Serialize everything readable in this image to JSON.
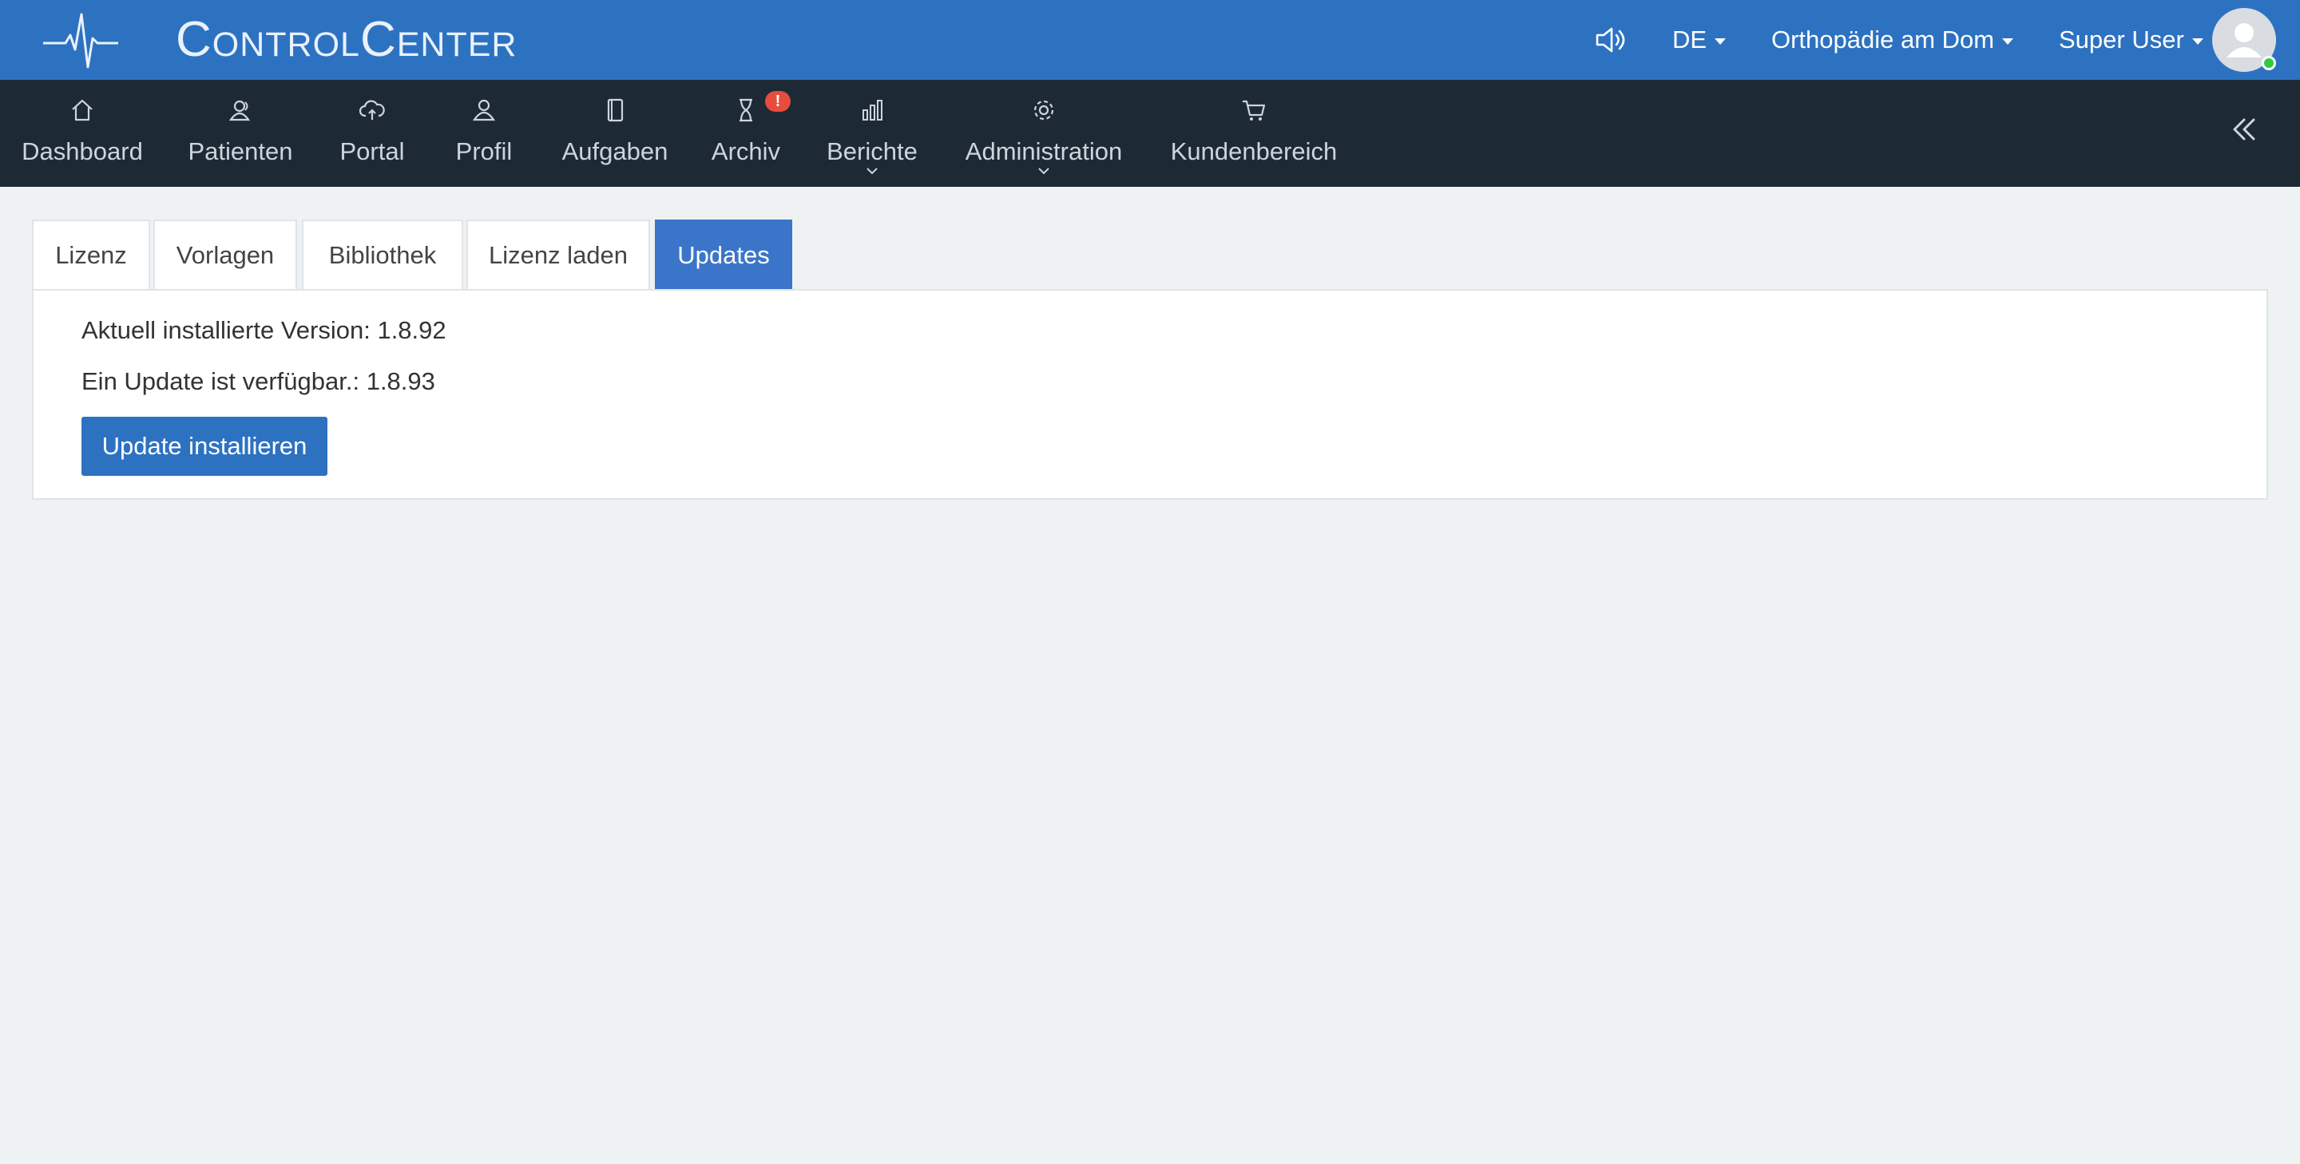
{
  "header": {
    "app_title": "ControlCenter",
    "language": "DE",
    "practice": "Orthopädie am Dom",
    "user": "Super User",
    "brand_color": "#2d72c1"
  },
  "nav": {
    "items": [
      {
        "label": "Dashboard",
        "icon": "home-icon"
      },
      {
        "label": "Patienten",
        "icon": "patients-icon"
      },
      {
        "label": "Portal",
        "icon": "cloud-upload-icon"
      },
      {
        "label": "Profil",
        "icon": "user-icon"
      },
      {
        "label": "Aufgaben",
        "icon": "notebook-icon"
      },
      {
        "label": "Archiv",
        "icon": "hourglass-icon",
        "badge": "!"
      },
      {
        "label": "Berichte",
        "icon": "bar-chart-icon",
        "dropdown": true
      },
      {
        "label": "Administration",
        "icon": "gear-icon",
        "dropdown": true
      },
      {
        "label": "Kundenbereich",
        "icon": "cart-icon"
      }
    ]
  },
  "tabs": [
    {
      "label": "Lizenz",
      "active": false
    },
    {
      "label": "Vorlagen",
      "active": false
    },
    {
      "label": "Bibliothek",
      "active": false
    },
    {
      "label": "Lizenz laden",
      "active": false
    },
    {
      "label": "Updates",
      "active": true
    }
  ],
  "updates": {
    "installed_text": "Aktuell installierte Version: 1.8.92",
    "available_text": "Ein Update ist verfügbar.: 1.8.93",
    "install_button": "Update installieren"
  }
}
